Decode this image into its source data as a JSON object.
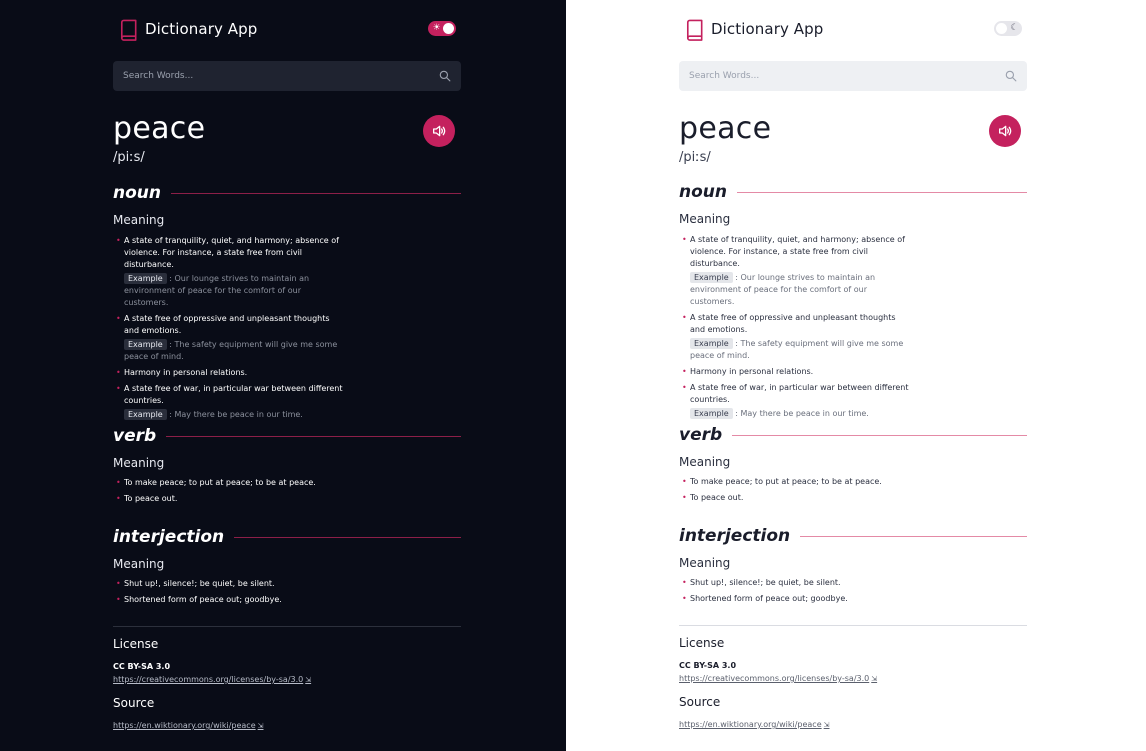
{
  "app": {
    "name": "Dictionary App"
  },
  "search": {
    "placeholder": "Search Words..."
  },
  "entry": {
    "word": "peace",
    "phonetic": "/piːs/",
    "meanings": [
      {
        "part_of_speech": "noun",
        "heading": "Meaning",
        "definitions": [
          {
            "text": "A state of tranquility, quiet, and harmony; absence of violence. For instance, a state free from civil disturbance.",
            "example_label": "Example",
            "example": ": Our lounge strives to maintain an environment of peace for the comfort of our customers."
          },
          {
            "text": "A state free of oppressive and unpleasant thoughts and emotions.",
            "example_label": "Example",
            "example": ": The safety equipment will give me some peace of mind."
          },
          {
            "text": "Harmony in personal relations."
          },
          {
            "text": "A state free of war, in particular war between different countries.",
            "example_label": "Example",
            "example": ": May there be peace in our time."
          }
        ]
      },
      {
        "part_of_speech": "verb",
        "heading": "Meaning",
        "definitions": [
          {
            "text": "To make peace; to put at peace; to be at peace."
          },
          {
            "text": "To peace out."
          }
        ]
      },
      {
        "part_of_speech": "interjection",
        "heading": "Meaning",
        "definitions": [
          {
            "text": "Shut up!, silence!; be quiet, be silent."
          },
          {
            "text": "Shortened form of peace out; goodbye."
          }
        ]
      }
    ]
  },
  "license": {
    "heading": "License",
    "name": "CC BY-SA 3.0",
    "url": "https://creativecommons.org/licenses/by-sa/3.0"
  },
  "source": {
    "heading": "Source",
    "url": "https://en.wiktionary.org/wiki/peace"
  },
  "theme": {
    "accent": "#c4215e",
    "dark_bg": "#090c17",
    "light_bg": "#ffffff"
  },
  "icons": {
    "brand": "book-icon",
    "search": "search-icon",
    "audio": "speaker-icon",
    "dark_toggle": "sun-icon",
    "light_toggle": "moon-icon",
    "external": "external-link-icon"
  }
}
